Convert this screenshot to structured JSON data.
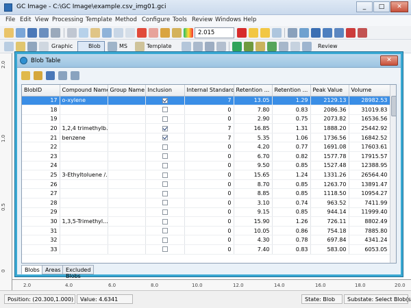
{
  "window": {
    "title": "GC Image - C:\\GC Image\\example.csv_img01.gci"
  },
  "menu": [
    "File",
    "Edit",
    "View",
    "Processing",
    "Template",
    "Method",
    "Configure",
    "Tools",
    "Review",
    "Windows",
    "Help"
  ],
  "toolbar1": {
    "value_select": "2.015"
  },
  "toolbar2": {
    "graphic_label": "Graphic",
    "blob_label": "Blob",
    "ms_label": "MS",
    "template_label": "Template",
    "review_label": "Review"
  },
  "ruler": {
    "v_labels": [
      "2.0",
      "1.0",
      "0.5",
      "0"
    ],
    "h_labels": [
      "2.0",
      "4.0",
      "6.0",
      "8.0",
      "10.0",
      "12.0",
      "14.0",
      "16.0",
      "18.0",
      "20.0"
    ]
  },
  "blob_table": {
    "title": "Blob Table",
    "columns": [
      "BlobID",
      "Compound Name",
      "Group Name",
      "Inclusion",
      "Internal Standard",
      "Retention ...",
      "Retention ...",
      "Peak Value",
      "Volume"
    ],
    "rows": [
      {
        "id": "17",
        "compound": "o-xylene",
        "group": "",
        "inclusion": true,
        "istd": "7",
        "rt1": "13.05",
        "rt2": "1.29",
        "peak": "2129.13",
        "volume": "28982.53",
        "selected": true
      },
      {
        "id": "18",
        "compound": "",
        "group": "",
        "inclusion": false,
        "istd": "0",
        "rt1": "7.80",
        "rt2": "0.83",
        "peak": "2086.36",
        "volume": "31019.83"
      },
      {
        "id": "19",
        "compound": "",
        "group": "",
        "inclusion": false,
        "istd": "0",
        "rt1": "2.90",
        "rt2": "0.75",
        "peak": "2073.82",
        "volume": "16536.56"
      },
      {
        "id": "20",
        "compound": "1,2,4 trimethylb...",
        "group": "",
        "inclusion": true,
        "istd": "7",
        "rt1": "16.85",
        "rt2": "1.31",
        "peak": "1888.20",
        "volume": "25442.92"
      },
      {
        "id": "21",
        "compound": "benzene",
        "group": "",
        "inclusion": true,
        "istd": "7",
        "rt1": "5.35",
        "rt2": "1.06",
        "peak": "1736.56",
        "volume": "16842.52"
      },
      {
        "id": "22",
        "compound": "",
        "group": "",
        "inclusion": false,
        "istd": "0",
        "rt1": "4.20",
        "rt2": "0.77",
        "peak": "1691.08",
        "volume": "17603.61"
      },
      {
        "id": "23",
        "compound": "",
        "group": "",
        "inclusion": false,
        "istd": "0",
        "rt1": "6.70",
        "rt2": "0.82",
        "peak": "1577.78",
        "volume": "17915.57"
      },
      {
        "id": "24",
        "compound": "",
        "group": "",
        "inclusion": false,
        "istd": "0",
        "rt1": "9.50",
        "rt2": "0.85",
        "peak": "1527.48",
        "volume": "12388.95"
      },
      {
        "id": "25",
        "compound": "3-Ethyltoluene /...",
        "group": "",
        "inclusion": false,
        "istd": "0",
        "rt1": "15.65",
        "rt2": "1.24",
        "peak": "1331.26",
        "volume": "26564.40"
      },
      {
        "id": "26",
        "compound": "",
        "group": "",
        "inclusion": false,
        "istd": "0",
        "rt1": "8.70",
        "rt2": "0.85",
        "peak": "1263.70",
        "volume": "13891.47"
      },
      {
        "id": "27",
        "compound": "",
        "group": "",
        "inclusion": false,
        "istd": "0",
        "rt1": "8.85",
        "rt2": "0.85",
        "peak": "1118.50",
        "volume": "10954.27"
      },
      {
        "id": "28",
        "compound": "",
        "group": "",
        "inclusion": false,
        "istd": "0",
        "rt1": "3.10",
        "rt2": "0.74",
        "peak": "963.52",
        "volume": "7411.99"
      },
      {
        "id": "29",
        "compound": "",
        "group": "",
        "inclusion": false,
        "istd": "0",
        "rt1": "9.15",
        "rt2": "0.85",
        "peak": "944.14",
        "volume": "11999.40"
      },
      {
        "id": "30",
        "compound": "1,3,5-Trimethyl...",
        "group": "",
        "inclusion": false,
        "istd": "0",
        "rt1": "15.90",
        "rt2": "1.26",
        "peak": "726.11",
        "volume": "8802.49"
      },
      {
        "id": "31",
        "compound": "",
        "group": "",
        "inclusion": false,
        "istd": "0",
        "rt1": "10.05",
        "rt2": "0.86",
        "peak": "754.18",
        "volume": "7885.80"
      },
      {
        "id": "32",
        "compound": "",
        "group": "",
        "inclusion": false,
        "istd": "0",
        "rt1": "4.30",
        "rt2": "0.78",
        "peak": "697.84",
        "volume": "4341.24"
      },
      {
        "id": "33",
        "compound": "",
        "group": "",
        "inclusion": false,
        "istd": "0",
        "rt1": "7.40",
        "rt2": "0.83",
        "peak": "583.00",
        "volume": "6053.05"
      }
    ],
    "tabs": [
      "Blobs",
      "Areas",
      "Excluded Blobs"
    ]
  },
  "status": {
    "position": "Position: (20.300,1.000)",
    "value": "Value: 4.6341",
    "state": "State: Blob",
    "substate": "Substate: Select Blob(s)"
  }
}
